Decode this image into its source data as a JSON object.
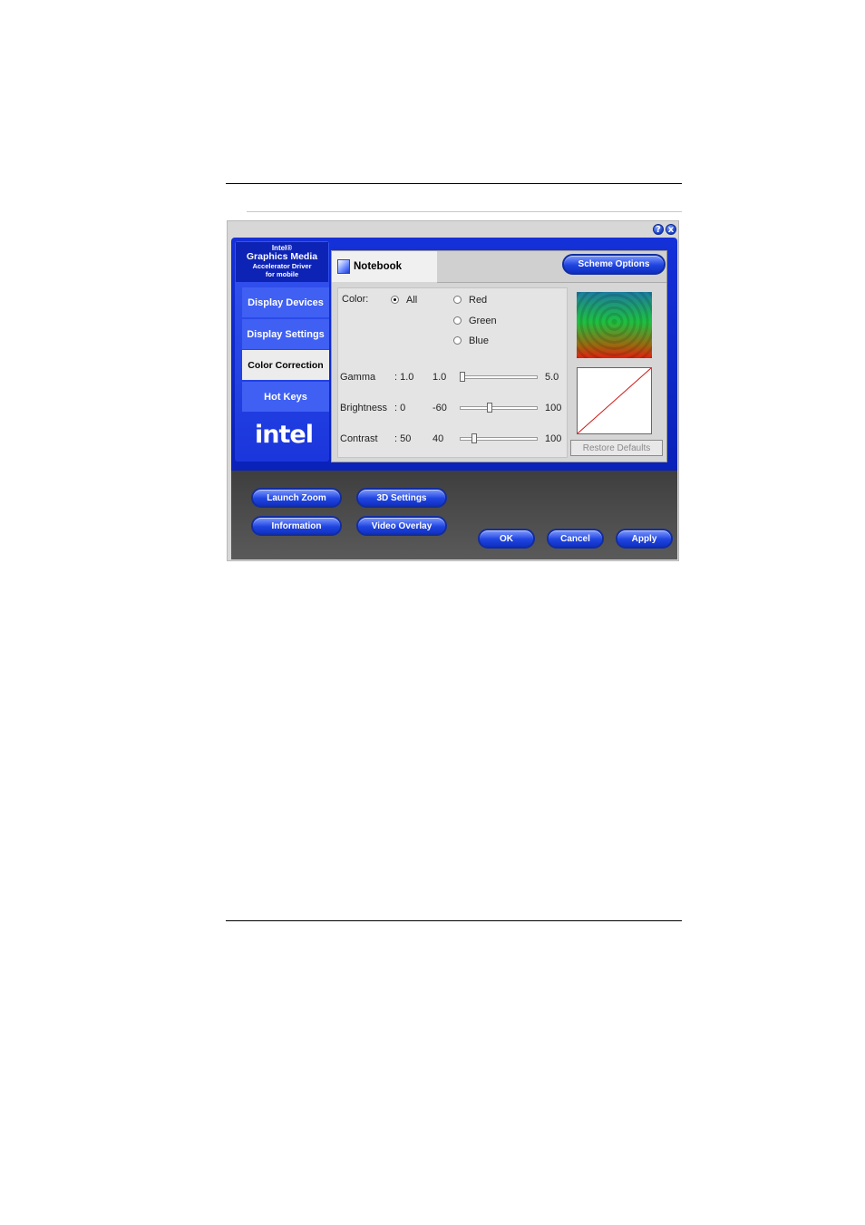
{
  "window": {
    "help_icon": "?",
    "close_icon": "x"
  },
  "brand": {
    "line1": "Intel®",
    "line2": "Graphics Media",
    "line3": "Accelerator Driver",
    "line4": "for mobile"
  },
  "sidebar": {
    "items": [
      {
        "label": "Display Devices"
      },
      {
        "label": "Display Settings"
      },
      {
        "label": "Color Correction"
      },
      {
        "label": "Hot Keys"
      }
    ],
    "logo": "intel"
  },
  "tab": {
    "label": "Notebook"
  },
  "scheme_options": "Scheme Options",
  "color": {
    "label": "Color:",
    "options": [
      "All",
      "Red",
      "Green",
      "Blue"
    ],
    "selected": "All"
  },
  "sliders": [
    {
      "name": "Gamma",
      "value_text": ": 1.0",
      "min": "1.0",
      "max": "5.0",
      "level": 0.0
    },
    {
      "name": "Brightness",
      "value_text": ": 0",
      "min": "-60",
      "max": "100",
      "level": 0.375
    },
    {
      "name": "Contrast",
      "value_text": ": 50",
      "min": "40",
      "max": "100",
      "level": 0.167
    }
  ],
  "restore_defaults": "Restore Defaults",
  "buttons": {
    "launch_zoom": "Launch Zoom",
    "settings_3d": "3D Settings",
    "information": "Information",
    "video_overlay": "Video Overlay",
    "ok": "OK",
    "cancel": "Cancel",
    "apply": "Apply"
  },
  "colors": {
    "brand_blue": "#1430d8",
    "curve": "#d01010"
  }
}
